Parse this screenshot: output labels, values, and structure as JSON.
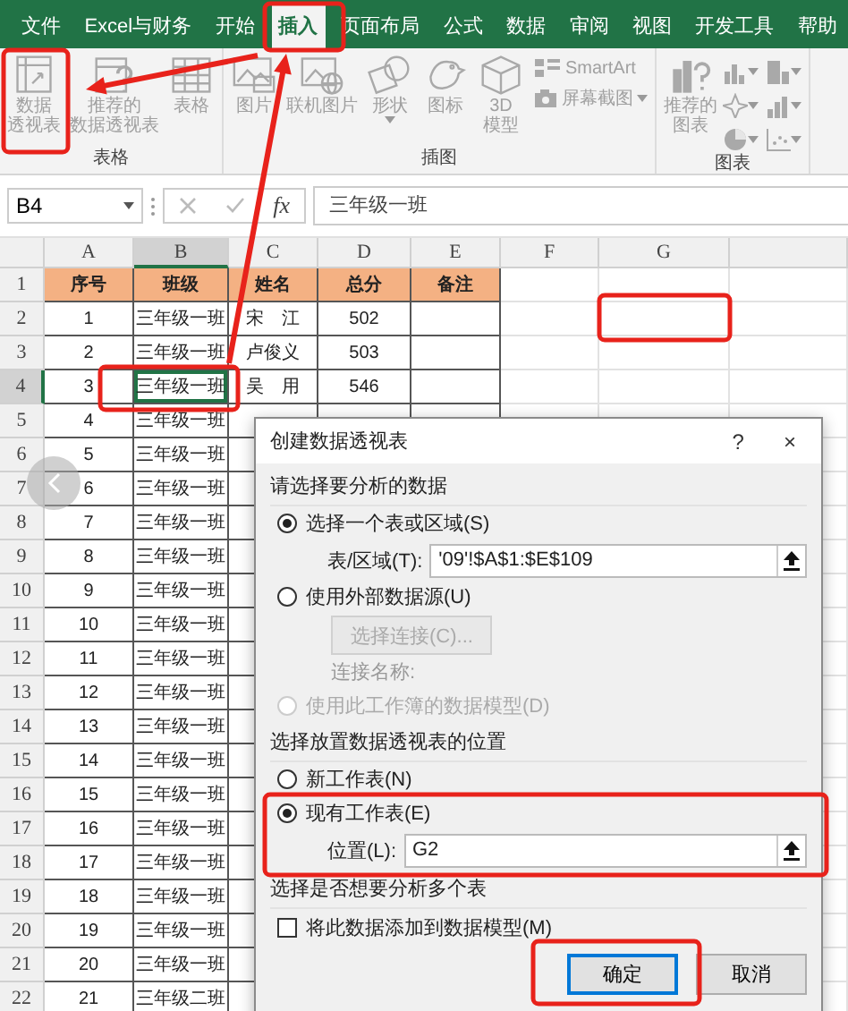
{
  "ribbon_tabs": [
    {
      "label": "文件",
      "selected": false
    },
    {
      "label": "Excel与财务",
      "selected": false
    },
    {
      "label": "开始",
      "selected": false
    },
    {
      "label": "插入",
      "selected": true
    },
    {
      "label": "页面布局",
      "selected": false
    },
    {
      "label": "公式",
      "selected": false
    },
    {
      "label": "数据",
      "selected": false
    },
    {
      "label": "审阅",
      "selected": false
    },
    {
      "label": "视图",
      "selected": false
    },
    {
      "label": "开发工具",
      "selected": false
    },
    {
      "label": "帮助",
      "selected": false
    }
  ],
  "ribbon_groups": [
    {
      "label": "表格",
      "buttons": [
        {
          "lines": [
            "数据",
            "透视表"
          ],
          "dropdown": false
        },
        {
          "lines": [
            "推荐的",
            "数据透视表"
          ],
          "dropdown": false
        },
        {
          "lines": [
            "表格"
          ],
          "dropdown": false
        }
      ]
    },
    {
      "label": "插图",
      "buttons": [
        {
          "lines": [
            "图片"
          ],
          "dropdown": false
        },
        {
          "lines": [
            "联机图片"
          ],
          "dropdown": false
        },
        {
          "lines": [
            "形状"
          ],
          "dropdown": true
        },
        {
          "lines": [
            "图标"
          ],
          "dropdown": false
        },
        {
          "lines": [
            "3D",
            "模型"
          ],
          "dropdown": false
        }
      ],
      "small_buttons": [
        {
          "label": "SmartArt",
          "dropdown": false
        },
        {
          "label": "屏幕截图",
          "dropdown": true
        }
      ]
    },
    {
      "label": "图表",
      "buttons": [
        {
          "lines": [
            "推荐的",
            "图表"
          ],
          "dropdown": false
        }
      ]
    }
  ],
  "formula_bar": {
    "name_box": "B4",
    "function_label": "fx",
    "formula": "三年级一班"
  },
  "sheet": {
    "columns": [
      {
        "label": "A",
        "selected": false
      },
      {
        "label": "B",
        "selected": true
      },
      {
        "label": "C",
        "selected": false
      },
      {
        "label": "D",
        "selected": false
      },
      {
        "label": "E",
        "selected": false
      },
      {
        "label": "F",
        "selected": false
      },
      {
        "label": "G",
        "selected": false
      }
    ],
    "rows": [
      {
        "number": "1",
        "kind": "header",
        "selected": false,
        "cells": [
          "序号",
          "班级",
          "姓名",
          "总分",
          "备注"
        ]
      },
      {
        "number": "2",
        "kind": "data",
        "selected": false,
        "cells": [
          "1",
          "三年级一班",
          "宋　江",
          "502"
        ]
      },
      {
        "number": "3",
        "kind": "data",
        "selected": false,
        "cells": [
          "2",
          "三年级一班",
          "卢俊义",
          "503"
        ]
      },
      {
        "number": "4",
        "kind": "data",
        "selected": true,
        "cells": [
          "3",
          "三年级一班",
          "吴　用",
          "546"
        ]
      },
      {
        "number": "5",
        "kind": "data",
        "selected": false,
        "cells": [
          "4",
          "三年级一班"
        ]
      },
      {
        "number": "6",
        "kind": "data",
        "selected": false,
        "cells": [
          "5",
          "三年级一班"
        ]
      },
      {
        "number": "7",
        "kind": "data",
        "selected": false,
        "cells": [
          "6",
          "三年级一班"
        ]
      },
      {
        "number": "8",
        "kind": "data",
        "selected": false,
        "cells": [
          "7",
          "三年级一班"
        ]
      },
      {
        "number": "9",
        "kind": "data",
        "selected": false,
        "cells": [
          "8",
          "三年级一班"
        ]
      },
      {
        "number": "10",
        "kind": "data",
        "selected": false,
        "cells": [
          "9",
          "三年级一班"
        ]
      },
      {
        "number": "11",
        "kind": "data",
        "selected": false,
        "cells": [
          "10",
          "三年级一班"
        ]
      },
      {
        "number": "12",
        "kind": "data",
        "selected": false,
        "cells": [
          "11",
          "三年级一班"
        ]
      },
      {
        "number": "13",
        "kind": "data",
        "selected": false,
        "cells": [
          "12",
          "三年级一班"
        ]
      },
      {
        "number": "14",
        "kind": "data",
        "selected": false,
        "cells": [
          "13",
          "三年级一班"
        ]
      },
      {
        "number": "15",
        "kind": "data",
        "selected": false,
        "cells": [
          "14",
          "三年级一班"
        ]
      },
      {
        "number": "16",
        "kind": "data",
        "selected": false,
        "cells": [
          "15",
          "三年级一班"
        ]
      },
      {
        "number": "17",
        "kind": "data",
        "selected": false,
        "cells": [
          "16",
          "三年级一班"
        ]
      },
      {
        "number": "18",
        "kind": "data",
        "selected": false,
        "cells": [
          "17",
          "三年级一班"
        ]
      },
      {
        "number": "19",
        "kind": "data",
        "selected": false,
        "cells": [
          "18",
          "三年级一班"
        ]
      },
      {
        "number": "20",
        "kind": "data",
        "selected": false,
        "cells": [
          "19",
          "三年级一班"
        ]
      },
      {
        "number": "21",
        "kind": "data",
        "selected": false,
        "cells": [
          "20",
          "三年级一班"
        ]
      },
      {
        "number": "22",
        "kind": "data",
        "selected": false,
        "cells": [
          "21",
          "三年级二班"
        ]
      }
    ]
  },
  "dialog": {
    "title": "创建数据透视表",
    "help": "?",
    "close": "×",
    "items": [
      {
        "kind": "heading",
        "label": "请选择要分析的数据"
      },
      {
        "kind": "radio",
        "label": "选择一个表或区域(S)",
        "selected": true,
        "disabled": false
      },
      {
        "kind": "field",
        "label": "表/区域(T):",
        "value": "'09'!$A$1:$E$109"
      },
      {
        "kind": "radio",
        "label": "使用外部数据源(U)",
        "selected": false,
        "disabled": false
      },
      {
        "kind": "button",
        "label": "选择连接(C)...",
        "disabled": true
      },
      {
        "kind": "note",
        "label": "连接名称:"
      },
      {
        "kind": "radio",
        "label": "使用此工作簿的数据模型(D)",
        "selected": false,
        "disabled": true
      },
      {
        "kind": "heading",
        "label": "选择放置数据透视表的位置"
      },
      {
        "kind": "radio",
        "label": "新工作表(N)",
        "selected": false,
        "disabled": false
      },
      {
        "kind": "radio",
        "label": "现有工作表(E)",
        "selected": true,
        "disabled": false
      },
      {
        "kind": "field",
        "label": "位置(L):",
        "value": "G2"
      },
      {
        "kind": "heading",
        "label": "选择是否想要分析多个表"
      },
      {
        "kind": "checkbox",
        "label": "将此数据添加到数据模型(M)",
        "checked": false
      }
    ],
    "buttons": [
      {
        "label": "确定",
        "default": true
      },
      {
        "label": "取消",
        "default": false
      }
    ]
  }
}
